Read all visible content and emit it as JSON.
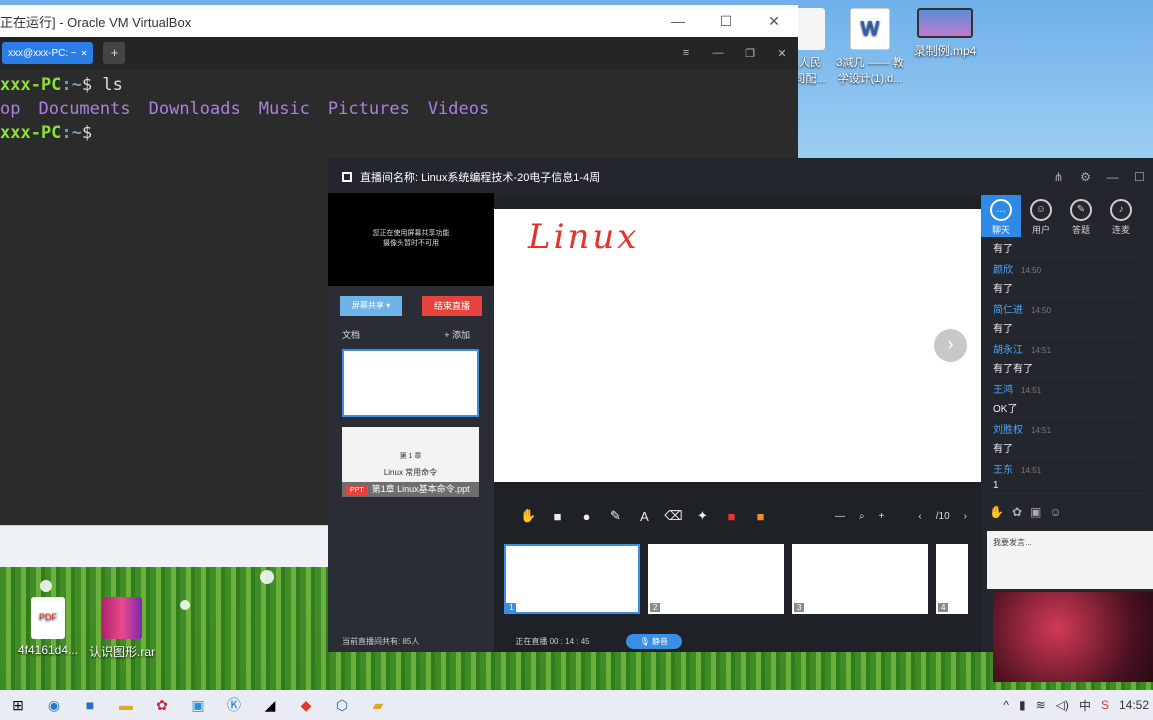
{
  "vbox": {
    "title": "正在运行] - Oracle VM VirtualBox",
    "tab": "xxx@xxx-PC: ~",
    "lines": {
      "p1_user": "xxx-PC",
      "p1_path": ":~",
      "p1_cmd": "$ ls",
      "ls": [
        "op",
        "Documents",
        "Downloads",
        "Music",
        "Pictures",
        "Videos"
      ],
      "p2_user": "xxx-PC",
      "p2_path": ":~",
      "p2_cmd": "$"
    }
  },
  "desktop_icons": {
    "doc1": "人民\n司配...",
    "doc2": "3减几 —— 教\n学设计(1).d...",
    "video": "录制例.mp4",
    "pdf": "4f4161d4...",
    "rar": "认识图形.rar"
  },
  "live": {
    "title": "直播间名称: Linux系统编程技术-20电子信息1-4周",
    "camera_notice_1": "您正在使用屏幕共享功能",
    "camera_notice_2": "摄像头暂时不可用",
    "share_btn": "屏幕共享 ▾",
    "end_btn": "结束直播",
    "docs_label": "文档",
    "add_label": "+ 添加",
    "ppt_chapter": "第 1 章",
    "ppt_subtitle": "Linux 常用命令",
    "ppt_tag": "PPT",
    "ppt_name": "第1章 Linux基本命令.ppt",
    "board_text": "Linux",
    "page_indicator": "/10",
    "thumb_nums": [
      "1",
      "2",
      "3",
      "4"
    ],
    "status_viewers": "当前直播间共有: 85人",
    "status_live": "正在直播 00 : 14 : 45",
    "mute_btn": "静音"
  },
  "right_tabs": [
    {
      "label": "聊天",
      "icon": "chat-icon"
    },
    {
      "label": "用户",
      "icon": "users-icon"
    },
    {
      "label": "答题",
      "icon": "pen-icon"
    },
    {
      "label": "连麦",
      "icon": "mic-icon"
    }
  ],
  "chat": {
    "first_msg": "有了",
    "messages": [
      {
        "name": "颜欣",
        "time": "14:50",
        "text": "有了"
      },
      {
        "name": "简仁进",
        "time": "14:50",
        "text": "有了"
      },
      {
        "name": "胡永江",
        "time": "14:51",
        "text": "有了有了"
      },
      {
        "name": "王鸿",
        "time": "14:51",
        "text": "OK了"
      },
      {
        "name": "刘胜权",
        "time": "14:51",
        "text": "有了"
      },
      {
        "name": "王东",
        "time": "14:51",
        "text": "1"
      }
    ],
    "input_placeholder": "我要发言..."
  },
  "taskbar": {
    "clock": "14:52",
    "ime": "中"
  }
}
